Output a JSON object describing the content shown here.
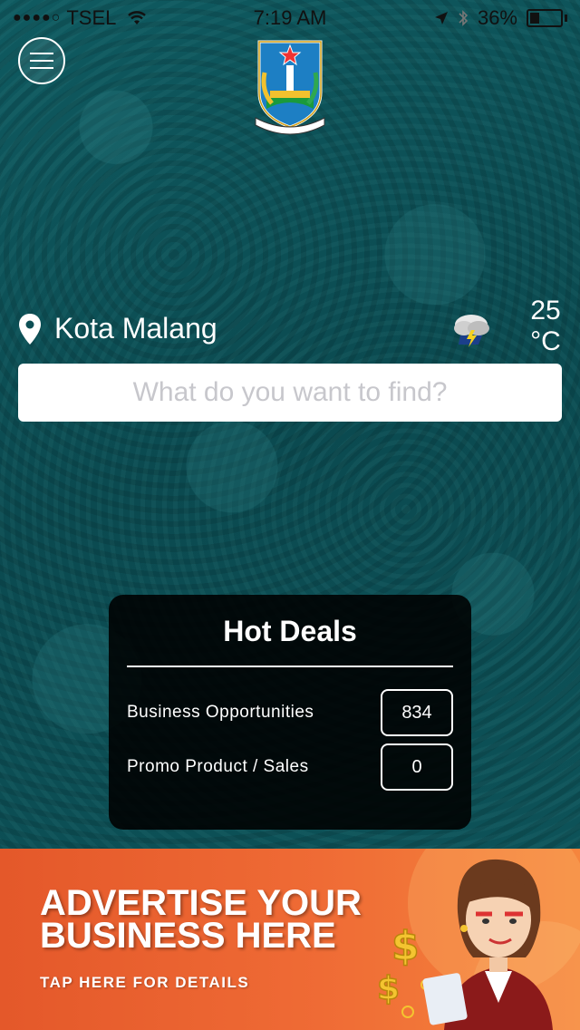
{
  "status_bar": {
    "carrier": "TSEL",
    "time": "7:19 AM",
    "battery": "36%",
    "battery_level": 0.36
  },
  "location": {
    "city": "Kota Malang",
    "temperature_value": "25",
    "temperature_unit": "°C",
    "weather_icon": "storm-cloud-icon"
  },
  "search": {
    "placeholder": "What do you want to find?"
  },
  "hot_deals": {
    "title": "Hot Deals",
    "rows": [
      {
        "label": "Business Opportunities",
        "count": "834"
      },
      {
        "label": "Promo Product / Sales",
        "count": "0"
      }
    ]
  },
  "ad_banner": {
    "line1": "ADVERTISE YOUR",
    "line2": "BUSINESS HERE",
    "cta": "TAP HERE FOR DETAILS"
  },
  "colors": {
    "background": "#0d4f55",
    "banner": "#ef6b35",
    "panel": "#000000"
  }
}
